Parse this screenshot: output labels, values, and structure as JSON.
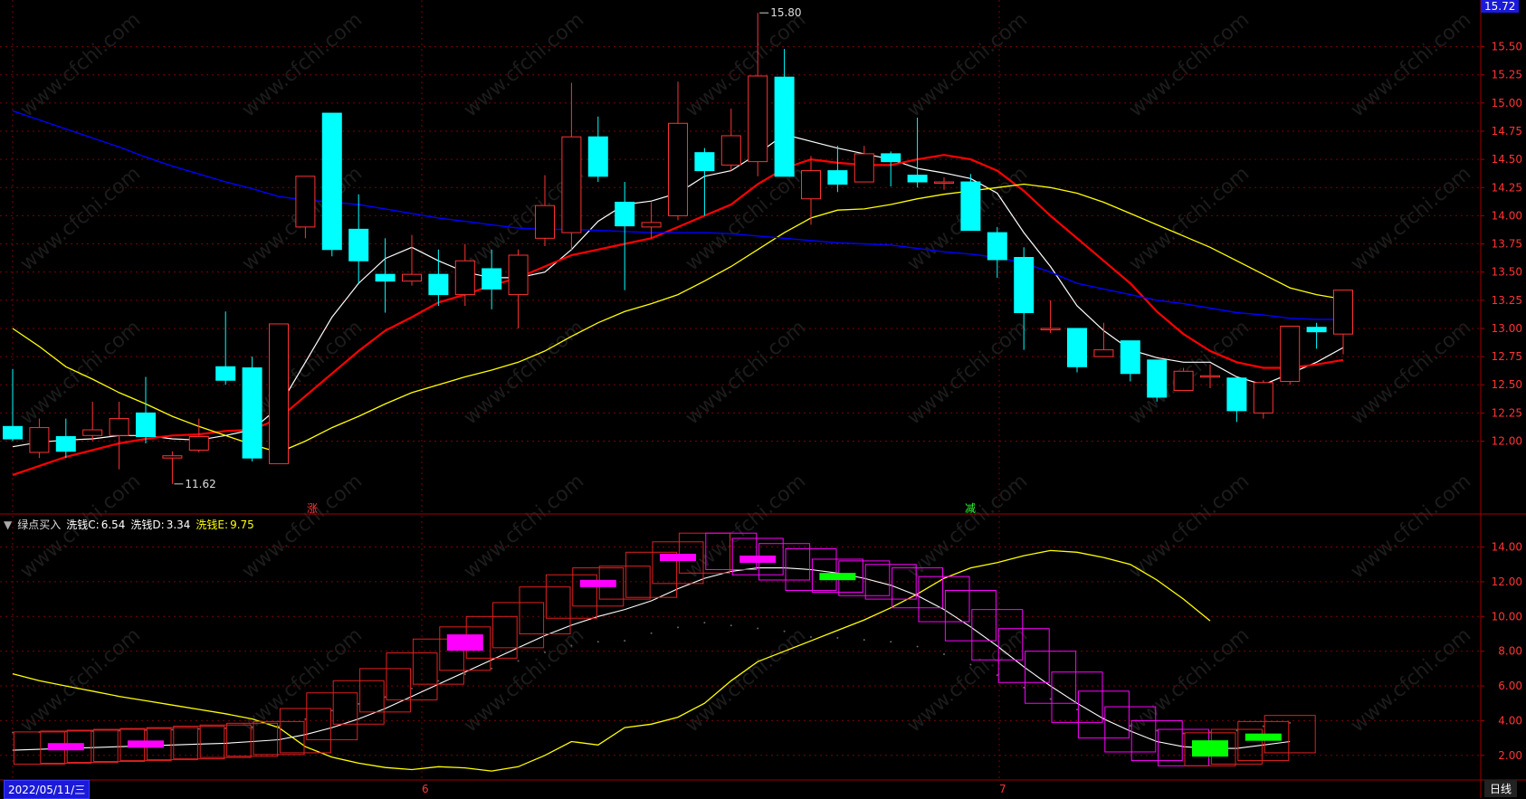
{
  "indicator": {
    "name": "绿点买入",
    "c_label": "洗钱C:",
    "c_value": "6.54",
    "d_label": "洗钱D:",
    "d_value": "3.34",
    "e_label": "洗钱E:",
    "e_value": "9.75"
  },
  "footer": {
    "date": "2022/05/11/三",
    "period": "日线",
    "month_labels": [
      "6",
      "7"
    ]
  },
  "markers": {
    "rise": "涨",
    "fall": "减"
  },
  "price_tag": "15.72",
  "colors": {
    "bg": "#000000",
    "up": "#ff3232",
    "down": "#00ffff",
    "ma5": "#ffffff",
    "ma10": "#ff0000",
    "ma20": "#ffff00",
    "ma60": "#0000ff",
    "grid": "#7a0000",
    "axis_text": "#ff3333",
    "magenta": "#ff00ff",
    "green": "#00ff00",
    "indicator_e": "#ffff00"
  },
  "chart_data": [
    {
      "type": "candlestick",
      "ylim": [
        11.45,
        15.85
      ],
      "y_ticks": [
        "12.00",
        "12.25",
        "12.50",
        "12.75",
        "13.00",
        "13.25",
        "13.50",
        "13.75",
        "14.00",
        "14.25",
        "14.50",
        "14.75",
        "15.00",
        "15.25",
        "15.50"
      ],
      "y_tick_values": [
        12.0,
        12.25,
        12.5,
        12.75,
        13.0,
        13.25,
        13.5,
        13.75,
        14.0,
        14.25,
        14.5,
        14.75,
        15.0,
        15.25,
        15.5
      ],
      "annotations": [
        {
          "text": "15.80",
          "index": 28,
          "value": 15.8
        },
        {
          "text": "11.62",
          "index": 6,
          "value": 11.62
        }
      ],
      "candles": [
        {
          "o": 12.13,
          "c": 12.02,
          "h": 12.64,
          "l": 12.0
        },
        {
          "o": 11.9,
          "c": 12.12,
          "h": 12.2,
          "l": 11.85
        },
        {
          "o": 12.04,
          "c": 11.91,
          "h": 12.2,
          "l": 11.85
        },
        {
          "o": 12.05,
          "c": 12.1,
          "h": 12.35,
          "l": 12.0
        },
        {
          "o": 12.05,
          "c": 12.2,
          "h": 12.35,
          "l": 11.75
        },
        {
          "o": 12.25,
          "c": 12.04,
          "h": 12.57,
          "l": 11.98
        },
        {
          "o": 11.85,
          "c": 11.87,
          "h": 11.91,
          "l": 11.62
        },
        {
          "o": 11.92,
          "c": 12.04,
          "h": 12.2,
          "l": 11.9
        },
        {
          "o": 12.66,
          "c": 12.54,
          "h": 13.15,
          "l": 12.5
        },
        {
          "o": 12.65,
          "c": 11.85,
          "h": 12.75,
          "l": 11.82
        },
        {
          "o": 11.8,
          "c": 13.04,
          "h": 13.04,
          "l": 11.8
        },
        {
          "o": 13.9,
          "c": 14.35,
          "h": 14.35,
          "l": 13.8
        },
        {
          "o": 14.91,
          "c": 13.7,
          "h": 14.91,
          "l": 13.64
        },
        {
          "o": 13.88,
          "c": 13.6,
          "h": 14.19,
          "l": 13.4
        },
        {
          "o": 13.48,
          "c": 13.42,
          "h": 13.8,
          "l": 13.14
        },
        {
          "o": 13.42,
          "c": 13.48,
          "h": 13.83,
          "l": 13.38
        },
        {
          "o": 13.48,
          "c": 13.3,
          "h": 13.7,
          "l": 13.2
        },
        {
          "o": 13.3,
          "c": 13.6,
          "h": 13.75,
          "l": 13.2
        },
        {
          "o": 13.53,
          "c": 13.35,
          "h": 13.7,
          "l": 13.17
        },
        {
          "o": 13.3,
          "c": 13.65,
          "h": 13.7,
          "l": 13.0
        },
        {
          "o": 13.8,
          "c": 14.09,
          "h": 14.36,
          "l": 13.73
        },
        {
          "o": 13.85,
          "c": 14.7,
          "h": 15.18,
          "l": 13.7
        },
        {
          "o": 14.7,
          "c": 14.35,
          "h": 14.88,
          "l": 14.3
        },
        {
          "o": 14.12,
          "c": 13.91,
          "h": 14.3,
          "l": 13.34
        },
        {
          "o": 13.9,
          "c": 13.94,
          "h": 14.12,
          "l": 13.8
        },
        {
          "o": 14.0,
          "c": 14.82,
          "h": 15.19,
          "l": 13.96
        },
        {
          "o": 14.56,
          "c": 14.4,
          "h": 14.6,
          "l": 14.0
        },
        {
          "o": 14.45,
          "c": 14.71,
          "h": 14.95,
          "l": 14.4
        },
        {
          "o": 14.48,
          "c": 15.24,
          "h": 15.8,
          "l": 14.35
        },
        {
          "o": 15.23,
          "c": 14.35,
          "h": 15.48,
          "l": 14.35
        },
        {
          "o": 14.15,
          "c": 14.4,
          "h": 14.53,
          "l": 13.92
        },
        {
          "o": 14.4,
          "c": 14.28,
          "h": 14.62,
          "l": 14.21
        },
        {
          "o": 14.3,
          "c": 14.55,
          "h": 14.62,
          "l": 14.3
        },
        {
          "o": 14.55,
          "c": 14.48,
          "h": 14.57,
          "l": 14.26
        },
        {
          "o": 14.36,
          "c": 14.3,
          "h": 14.87,
          "l": 14.25
        },
        {
          "o": 14.3,
          "c": 14.3,
          "h": 14.34,
          "l": 14.23
        },
        {
          "o": 14.3,
          "c": 13.87,
          "h": 14.37,
          "l": 13.87
        },
        {
          "o": 13.85,
          "c": 13.61,
          "h": 13.9,
          "l": 13.45
        },
        {
          "o": 13.63,
          "c": 13.14,
          "h": 13.72,
          "l": 12.81
        },
        {
          "o": 13.0,
          "c": 13.0,
          "h": 13.25,
          "l": 12.96
        },
        {
          "o": 13.0,
          "c": 12.66,
          "h": 13.0,
          "l": 12.61
        },
        {
          "o": 12.75,
          "c": 12.81,
          "h": 13.05,
          "l": 12.76
        },
        {
          "o": 12.89,
          "c": 12.6,
          "h": 12.89,
          "l": 12.53
        },
        {
          "o": 12.72,
          "c": 12.39,
          "h": 12.72,
          "l": 12.35
        },
        {
          "o": 12.45,
          "c": 12.62,
          "h": 12.65,
          "l": 12.45
        },
        {
          "o": 12.58,
          "c": 12.58,
          "h": 12.68,
          "l": 12.47
        },
        {
          "o": 12.56,
          "c": 12.27,
          "h": 12.56,
          "l": 12.17
        },
        {
          "o": 12.25,
          "c": 12.52,
          "h": 12.54,
          "l": 12.2
        },
        {
          "o": 12.53,
          "c": 13.02,
          "h": 13.02,
          "l": 12.5
        },
        {
          "o": 13.01,
          "c": 12.97,
          "h": 13.05,
          "l": 12.82
        },
        {
          "o": 12.95,
          "c": 13.34,
          "h": 13.34,
          "l": 12.77
        }
      ],
      "series": [
        {
          "key": "ma5",
          "start": 0,
          "values": [
            11.95,
            11.99,
            12.01,
            12.02,
            12.05,
            12.05,
            12.02,
            12.01,
            12.05,
            12.1,
            12.3,
            12.7,
            13.1,
            13.4,
            13.62,
            13.72,
            13.6,
            13.5,
            13.45,
            13.45,
            13.5,
            13.7,
            13.95,
            14.1,
            14.13,
            14.2,
            14.35,
            14.4,
            14.55,
            14.72,
            14.66,
            14.6,
            14.55,
            14.5,
            14.42,
            14.38,
            14.33,
            14.2,
            13.85,
            13.55,
            13.2,
            12.98,
            12.81,
            12.74,
            12.7,
            12.7,
            12.57,
            12.5,
            12.6,
            12.7,
            12.83
          ]
        },
        {
          "key": "ma10",
          "start": 0,
          "values": [
            11.7,
            11.78,
            11.86,
            11.92,
            11.98,
            12.02,
            12.05,
            12.06,
            12.09,
            12.1,
            12.2,
            12.4,
            12.6,
            12.8,
            12.98,
            13.1,
            13.23,
            13.3,
            13.38,
            13.45,
            13.55,
            13.65,
            13.7,
            13.75,
            13.8,
            13.9,
            14.0,
            14.1,
            14.28,
            14.42,
            14.5,
            14.47,
            14.45,
            14.45,
            14.5,
            14.54,
            14.5,
            14.4,
            14.22,
            14.0,
            13.8,
            13.6,
            13.4,
            13.15,
            12.95,
            12.8,
            12.7,
            12.65,
            12.65,
            12.68,
            12.72
          ]
        },
        {
          "key": "ma20",
          "start": 0,
          "values": [
            13.0,
            12.84,
            12.66,
            12.55,
            12.43,
            12.33,
            12.22,
            12.13,
            12.05,
            11.97,
            11.9,
            12.0,
            12.12,
            12.22,
            12.33,
            12.43,
            12.5,
            12.57,
            12.63,
            12.7,
            12.8,
            12.93,
            13.05,
            13.15,
            13.22,
            13.3,
            13.42,
            13.55,
            13.7,
            13.85,
            13.98,
            14.05,
            14.06,
            14.1,
            14.15,
            14.19,
            14.22,
            14.25,
            14.28,
            14.25,
            14.2,
            14.12,
            14.02,
            13.92,
            13.82,
            13.72,
            13.6,
            13.48,
            13.36,
            13.3,
            13.26
          ]
        },
        {
          "key": "ma60",
          "start": 0,
          "values": [
            14.93,
            14.85,
            14.77,
            14.69,
            14.61,
            14.52,
            14.44,
            14.37,
            14.3,
            14.24,
            14.17,
            14.14,
            14.12,
            14.1,
            14.06,
            14.02,
            13.98,
            13.95,
            13.92,
            13.89,
            13.88,
            13.88,
            13.87,
            13.86,
            13.85,
            13.85,
            13.85,
            13.84,
            13.82,
            13.8,
            13.78,
            13.76,
            13.75,
            13.74,
            13.71,
            13.68,
            13.66,
            13.63,
            13.58,
            13.5,
            13.4,
            13.35,
            13.3,
            13.25,
            13.22,
            13.18,
            13.14,
            13.12,
            13.09,
            13.08,
            13.08
          ]
        }
      ]
    },
    {
      "type": "indicator",
      "ylim": [
        1.0,
        15.8
      ],
      "y_ticks": [
        "2.00",
        "4.00",
        "6.00",
        "8.00",
        "10.00",
        "12.00",
        "14.00"
      ],
      "y_tick_values": [
        2,
        4,
        6,
        8,
        10,
        12,
        14
      ],
      "series": [
        {
          "name": "洗钱C",
          "key": "c",
          "start": 0,
          "values": [
            2.4,
            2.45,
            2.5,
            2.55,
            2.6,
            2.65,
            2.7,
            2.78,
            2.85,
            2.95,
            3.05,
            3.8,
            4.7,
            5.4,
            6.1,
            7.0,
            7.8,
            8.5,
            9.1,
            9.9,
            10.8,
            11.5,
            11.9,
            12.0,
            12.8,
            13.4,
            13.9,
            13.6,
            13.3,
            13.0,
            12.4,
            12.3,
            12.1,
            11.9,
            11.4,
            10.6,
            9.5,
            8.4,
            7.1,
            5.9,
            4.8,
            3.9,
            3.1,
            2.6,
            2.3,
            2.4,
            2.6,
            3.05,
            3.4
          ]
        },
        {
          "name": "洗钱D",
          "key": "d",
          "start": 0,
          "values": [
            2.3,
            2.35,
            2.4,
            2.45,
            2.5,
            2.55,
            2.6,
            2.65,
            2.7,
            2.8,
            2.9,
            3.2,
            3.6,
            4.1,
            4.7,
            5.4,
            6.1,
            6.8,
            7.5,
            8.2,
            8.9,
            9.5,
            10.0,
            10.4,
            10.9,
            11.6,
            12.2,
            12.6,
            12.8,
            12.8,
            12.7,
            12.5,
            12.2,
            11.8,
            11.2,
            10.4,
            9.4,
            8.3,
            7.1,
            6.0,
            5.0,
            4.1,
            3.4,
            2.8,
            2.5,
            2.4,
            2.4,
            2.6,
            2.8
          ]
        },
        {
          "name": "洗钱E",
          "key": "e",
          "start": 0,
          "values": [
            6.7,
            6.3,
            6.0,
            5.7,
            5.4,
            5.15,
            4.9,
            4.65,
            4.4,
            4.1,
            3.6,
            2.5,
            1.9,
            1.55,
            1.3,
            1.18,
            1.35,
            1.28,
            1.1,
            1.35,
            2.0,
            2.8,
            2.6,
            3.6,
            3.8,
            4.2,
            5.0,
            6.3,
            7.4,
            8.0,
            8.6,
            9.2,
            9.8,
            10.5,
            11.3,
            12.2,
            12.8,
            13.1,
            13.5,
            13.8,
            13.7,
            13.4,
            13.0,
            12.1,
            11.0,
            9.75
          ]
        }
      ]
    }
  ]
}
